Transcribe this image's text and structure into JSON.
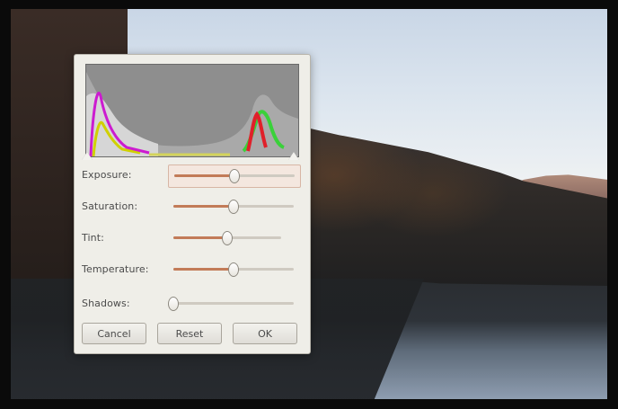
{
  "dialog": {
    "controls": [
      {
        "label": "Exposure:",
        "value": 0.5,
        "focused": true
      },
      {
        "label": "Saturation:",
        "value": 0.5,
        "focused": false
      },
      {
        "label": "Tint:",
        "value": 0.5,
        "focused": false
      },
      {
        "label": "Temperature:",
        "value": 0.5,
        "focused": false
      },
      {
        "label": "Shadows:",
        "value": 0.0,
        "focused": false
      }
    ],
    "buttons": {
      "cancel": "Cancel",
      "reset": "Reset",
      "ok": "OK"
    }
  },
  "colors": {
    "accent": "#c27b58",
    "dialog_bg": "#efeee8",
    "histogram_bg": "#7a7a7a"
  }
}
